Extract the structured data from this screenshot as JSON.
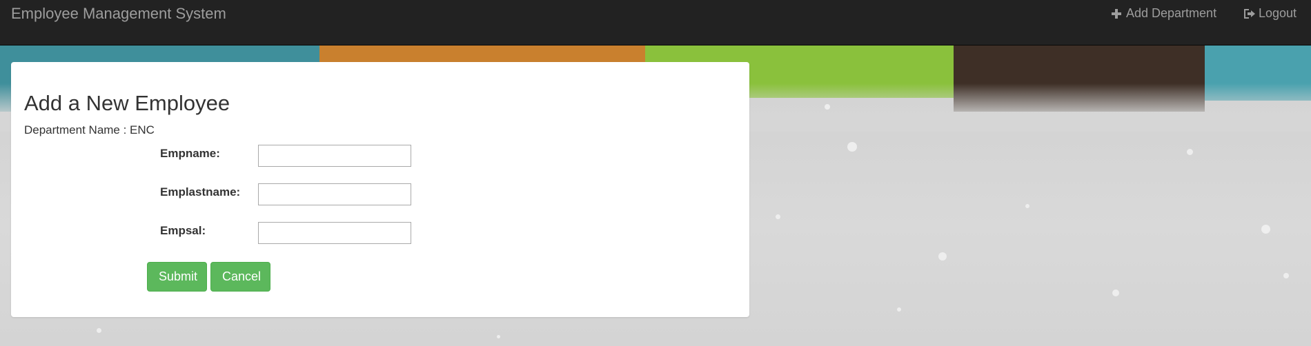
{
  "navbar": {
    "brand": "Employee Management System",
    "add_department": "Add Department",
    "logout": "Logout"
  },
  "form": {
    "title": "Add a New Employee",
    "department_line": "Department Name : ENC",
    "fields": [
      {
        "label": "Empname:",
        "value": ""
      },
      {
        "label": "Emplastname:",
        "value": ""
      },
      {
        "label": "Empsal:",
        "value": ""
      }
    ],
    "submit_label": "Submit",
    "cancel_label": "Cancel"
  },
  "colors": {
    "navbar_bg": "#222222",
    "navbar_text": "#9d9d9d",
    "button_green": "#5cb85c",
    "panel_bg": "#ffffff"
  },
  "icons": {
    "add_department": "plus-icon",
    "logout": "logout-icon"
  }
}
